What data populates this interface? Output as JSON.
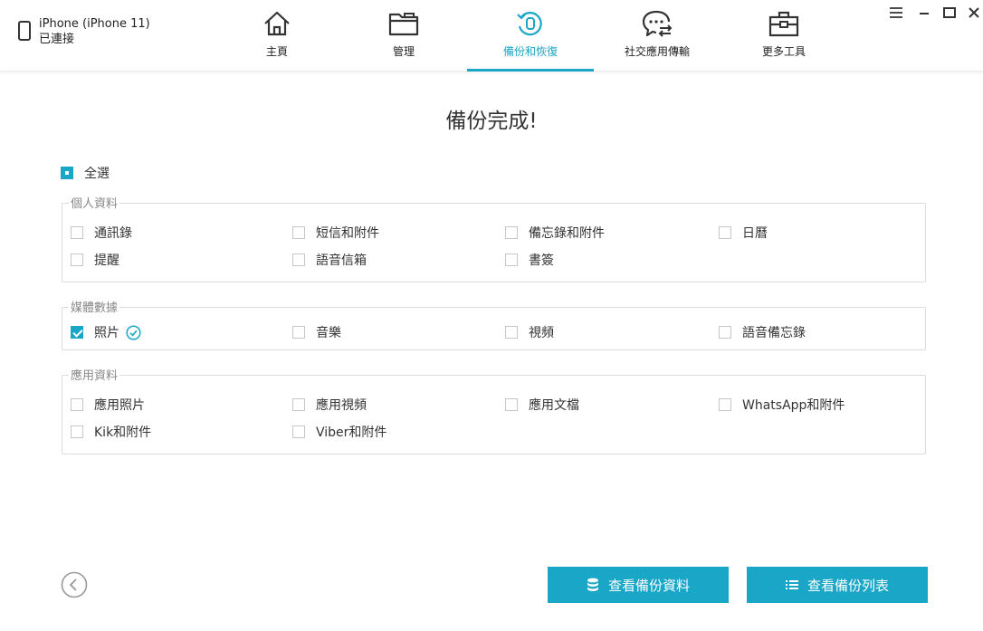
{
  "device": {
    "name": "iPhone (iPhone 11)",
    "status": "已連接"
  },
  "nav": {
    "tabs": [
      {
        "label": "主頁",
        "icon": "home-icon"
      },
      {
        "label": "管理",
        "icon": "folder-icon"
      },
      {
        "label": "備份和恢復",
        "icon": "backup-restore-icon",
        "active": true
      },
      {
        "label": "社交應用傳輸",
        "icon": "chat-transfer-icon"
      },
      {
        "label": "更多工具",
        "icon": "toolbox-icon"
      }
    ]
  },
  "window_controls": [
    "menu-icon",
    "minimize-icon",
    "maximize-icon",
    "close-icon"
  ],
  "main": {
    "title": "備份完成!",
    "select_all": "全選",
    "groups": [
      {
        "label": "個人資料",
        "items": [
          "通訊錄",
          "短信和附件",
          "備忘錄和附件",
          "日曆",
          "提醒",
          "語音信箱",
          "書簽"
        ]
      },
      {
        "label": "媒體數據",
        "items": [
          "照片",
          "音樂",
          "視頻",
          "語音備忘錄"
        ]
      },
      {
        "label": "應用資料",
        "items": [
          "應用照片",
          "應用視頻",
          "應用文檔",
          "WhatsApp和附件",
          "Kik和附件",
          "Viber和附件"
        ]
      }
    ]
  },
  "buttons": {
    "view_backup_data": "查看備份資料",
    "view_backup_list": "查看備份列表"
  },
  "colors": {
    "accent": "#1aa6c6"
  }
}
